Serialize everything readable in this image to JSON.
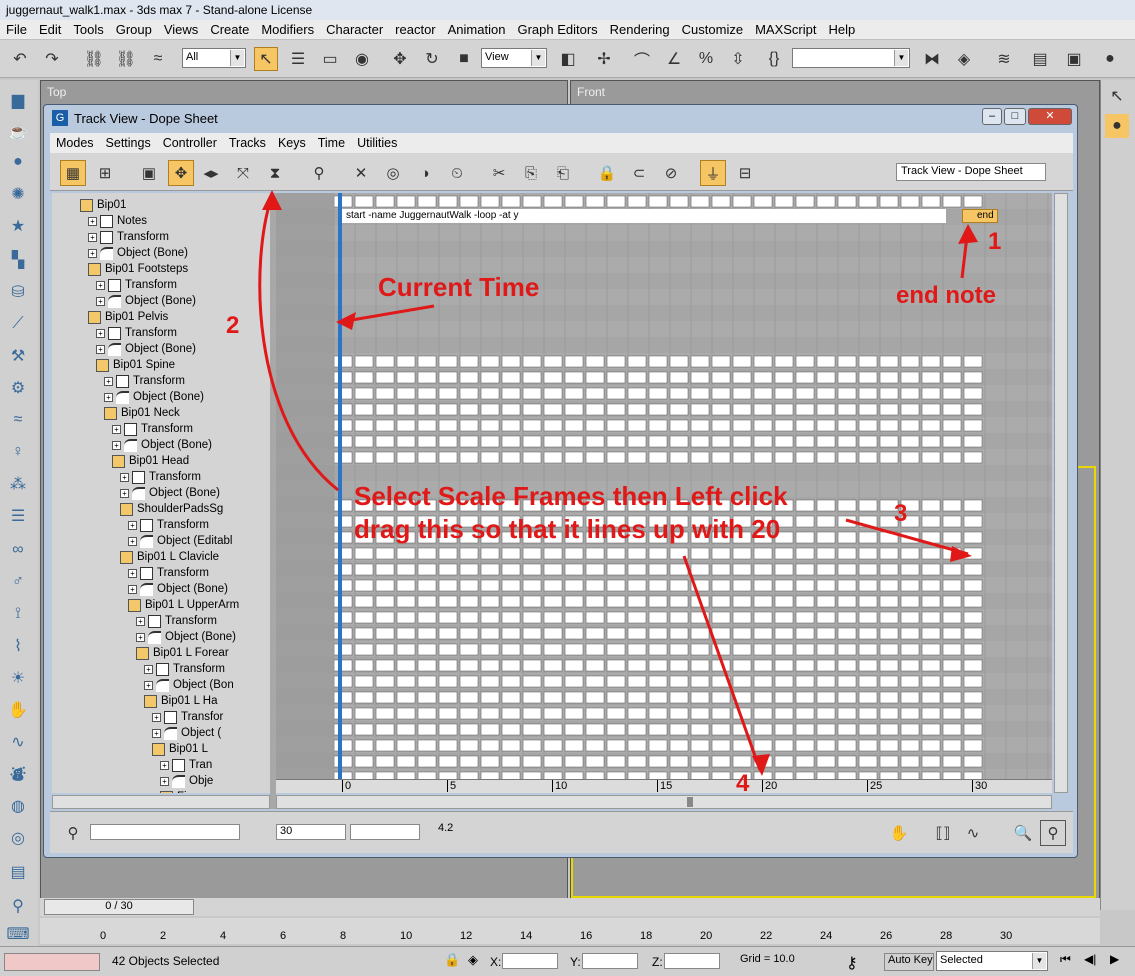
{
  "app": {
    "title": "juggernaut_walk1.max - 3ds max 7  - Stand-alone License",
    "menu": [
      "File",
      "Edit",
      "Tools",
      "Group",
      "Views",
      "Create",
      "Modifiers",
      "Character",
      "reactor",
      "Animation",
      "Graph Editors",
      "Rendering",
      "Customize",
      "MAXScript",
      "Help"
    ],
    "selection_filter": "All",
    "ref_coord": "View"
  },
  "viewports": {
    "top": "Top",
    "front": "Front"
  },
  "trackview": {
    "title": "Track View - Dope Sheet",
    "menu": [
      "Modes",
      "Settings",
      "Controller",
      "Tracks",
      "Keys",
      "Time",
      "Utilities"
    ],
    "name_field": "Track View - Dope Sheet",
    "tree": [
      "Bip01",
      "Notes",
      "Transform",
      "Object (Bone)",
      "Bip01 Footsteps",
      "Transform",
      "Object (Bone)",
      "Bip01 Pelvis",
      "Transform",
      "Object (Bone)",
      "Bip01 Spine",
      "Transform",
      "Object (Bone)",
      "Bip01 Neck",
      "Transform",
      "Object (Bone)",
      "Bip01 Head",
      "Transform",
      "Object (Bone)",
      "ShoulderPadsSg",
      "Transform",
      "Object (Editabl",
      "Bip01 L Clavicle",
      "Transform",
      "Object (Bone)",
      "Bip01 L UpperArm",
      "Transform",
      "Object (Bone)",
      "Bip01 L Forear",
      "Transform",
      "Object (Bon",
      "Bip01 L Ha",
      "Transfor",
      "Object (",
      "Bip01 L",
      "Tran",
      "Obje",
      "Fing"
    ],
    "note_text": "start -name JuggernautWalk -loop -at y",
    "end_label": "end",
    "ruler_ticks": [
      "0",
      "5",
      "10",
      "15",
      "20",
      "25",
      "30"
    ],
    "bottom_field": "30",
    "bottom_value": "4.2"
  },
  "annotations": {
    "current_time": "Current Time",
    "end_note": "end note",
    "instruction_line1": "Select Scale Frames then Left click",
    "instruction_line2": "drag this so that it lines up with 20",
    "n1": "1",
    "n2": "2",
    "n3": "3",
    "n4": "4",
    "color": "#e01818"
  },
  "timeline": {
    "frame_counter": "0 / 30",
    "ticks": [
      "0",
      "2",
      "4",
      "6",
      "8",
      "10",
      "12",
      "14",
      "16",
      "18",
      "20",
      "22",
      "24",
      "26",
      "28",
      "30"
    ]
  },
  "status": {
    "selected": "42 Objects Selected",
    "x_label": "X:",
    "y_label": "Y:",
    "z_label": "Z:",
    "grid": "Grid = 10.0",
    "autokey": "Auto Key",
    "selected_dd": "Selected"
  }
}
